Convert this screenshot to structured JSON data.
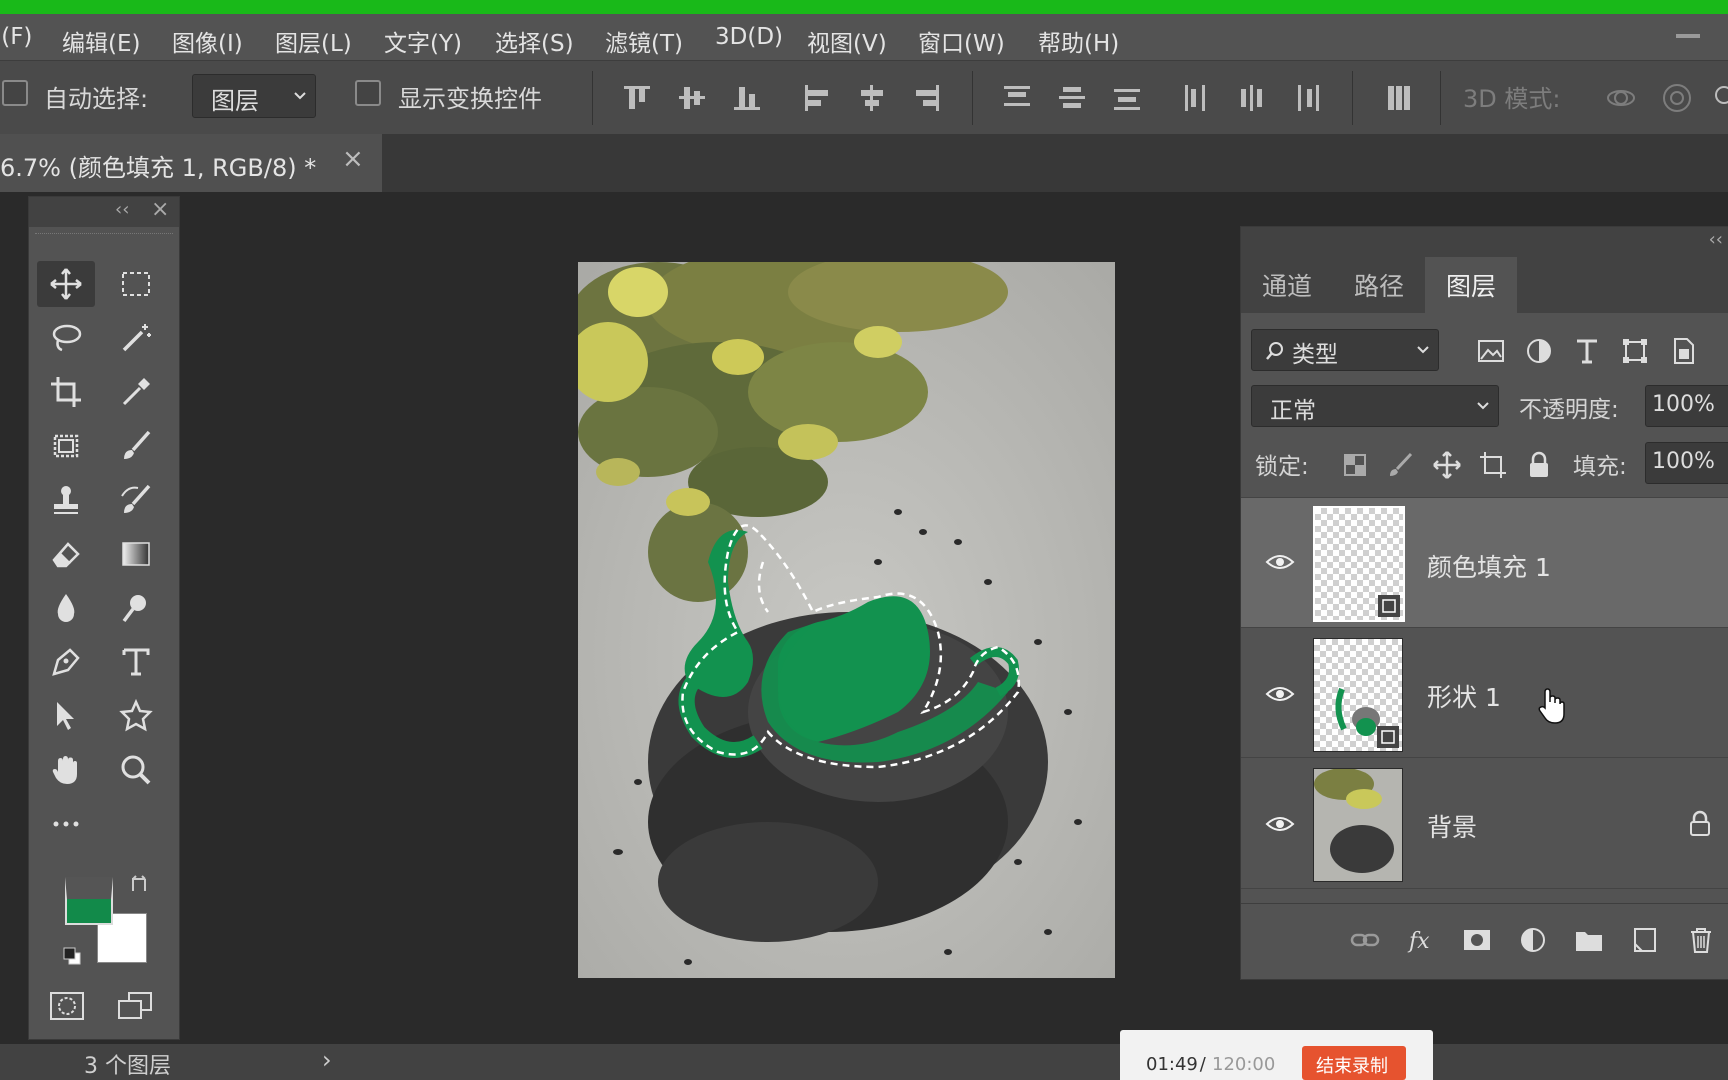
{
  "menubar": {
    "items": [
      "F(F)",
      "编辑(E)",
      "图像(I)",
      "图层(L)",
      "文字(Y)",
      "选择(S)",
      "滤镜(T)",
      "3D(D)",
      "视图(V)",
      "窗口(W)",
      "帮助(H)"
    ]
  },
  "options_bar": {
    "auto_select_label": "自动选择:",
    "auto_select_value": "图层",
    "show_transform_label": "显示变换控件",
    "mode_3d_label": "3D 模式:"
  },
  "document_tab": {
    "title": "6.7% (颜色填充 1, RGB/8) *",
    "close": "×"
  },
  "toolbox": {
    "collapse": "‹‹",
    "close": "×",
    "foreground_color": "#128a4a",
    "background_color": "#ffffff"
  },
  "layers_panel": {
    "tabs": [
      "通道",
      "路径",
      "图层"
    ],
    "active_tab": "图层",
    "filter_kind": "类型",
    "blend_mode": "正常",
    "opacity_label": "不透明度:",
    "opacity_value": "100%",
    "lock_label": "锁定:",
    "fill_label": "填充:",
    "fill_value": "100%",
    "layers": [
      {
        "name": "颜色填充 1",
        "selected": true
      },
      {
        "name": "形状 1",
        "selected": false
      },
      {
        "name": "背景",
        "selected": false,
        "locked": true
      }
    ]
  },
  "statusbar": {
    "layer_count": "3 个图层",
    "arrow": "›"
  },
  "recording": {
    "elapsed": "01:49",
    "separator": " / ",
    "total": "120:00",
    "stop_label": "结束录制"
  },
  "colors": {
    "accent_green": "#12924f",
    "top_strip": "#19b919"
  }
}
